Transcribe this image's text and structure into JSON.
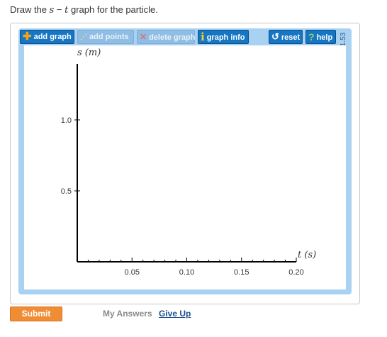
{
  "prompt": {
    "before": "Draw the ",
    "var1": "s",
    "dash": " − ",
    "var2": "t",
    "after": " graph for the particle."
  },
  "toolbar": {
    "add_graph": "add graph",
    "add_points": "add points",
    "delete_graph": "delete graph",
    "graph_info": "graph info",
    "reset": "reset",
    "help": "help"
  },
  "tool_id": "1.53",
  "chart_data": {
    "type": "line",
    "xlabel": "t (s)",
    "ylabel": "s (m)",
    "xlim": [
      0,
      0.2
    ],
    "ylim": [
      0,
      1.3
    ],
    "x_ticks": [
      "0.05",
      "0.10",
      "0.15",
      "0.20"
    ],
    "y_ticks": [
      "0.5",
      "1.0"
    ],
    "series": []
  },
  "actions": {
    "submit": "Submit",
    "my_answers": "My Answers",
    "give_up": "Give Up"
  }
}
